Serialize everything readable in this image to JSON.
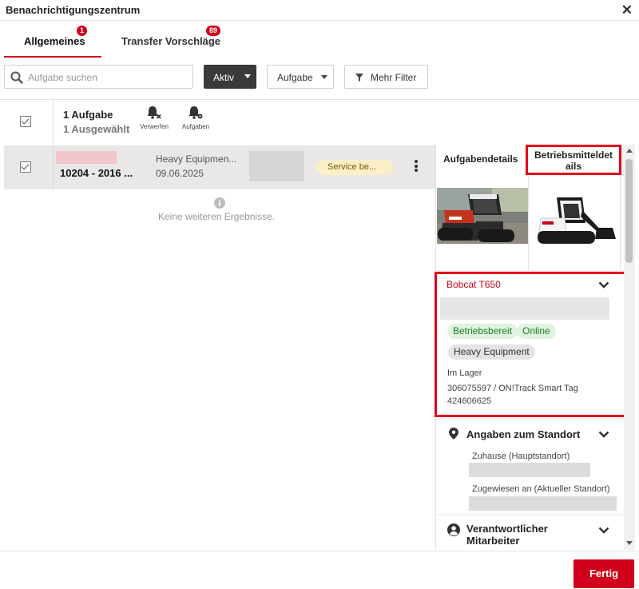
{
  "window": {
    "title": "Benachrichtigungszentrum",
    "close_label": "✕"
  },
  "tabs": [
    {
      "label": "Allgemeines",
      "badge": "1",
      "active": true
    },
    {
      "label": "Transfer Vorschläge",
      "badge": "89",
      "active": false
    }
  ],
  "toolbar": {
    "search_placeholder": "Aufgabe suchen",
    "status_filter": "Aktiv",
    "type_filter": "Aufgabe",
    "more_filter": "Mehr Filter"
  },
  "list_header": {
    "count": "1 Aufgabe",
    "selected": "1 Ausgewählt",
    "actions": [
      {
        "label": "Verwerfen",
        "icon": "bell-x-icon"
      },
      {
        "label": "Aufgaben",
        "icon": "bell-gear-icon"
      }
    ]
  },
  "rows": [
    {
      "title": "10204 - 2016 ...",
      "category": "Heavy Equipmen...",
      "date": "09.06.2025",
      "status": "Service be..."
    }
  ],
  "empty_message": "Keine weiteren Ergebnisse.",
  "details": {
    "tabs": [
      "Aufgabendetails",
      "Betriebsmitteldetails"
    ],
    "tab2_lines": [
      "Betriebsmitteldet",
      "ails"
    ],
    "asset": {
      "name": "Bobcat T650",
      "tags_green": [
        "Betriebsbereit",
        "Online"
      ],
      "tag_grey": "Heavy Equipment",
      "location_status": "Im Lager",
      "tag_line_1": "306075597 / ON!Track Smart Tag",
      "tag_line_2": "424606625"
    },
    "location_section": {
      "title": "Angaben zum Standort",
      "home_label": "Zuhause (Hauptstandort)",
      "assigned_label": "Zugewiesen an (Aktueller Standort)"
    },
    "responsible_section": {
      "title_lines": [
        "Verantwortlicher",
        "Mitarbeiter"
      ]
    }
  },
  "footer": {
    "done_label": "Fertig"
  },
  "colors": {
    "accent": "#d0021b",
    "highlight": "#e0001b",
    "status_bg": "#fbefc7",
    "tag_green_bg": "#dff3df"
  }
}
